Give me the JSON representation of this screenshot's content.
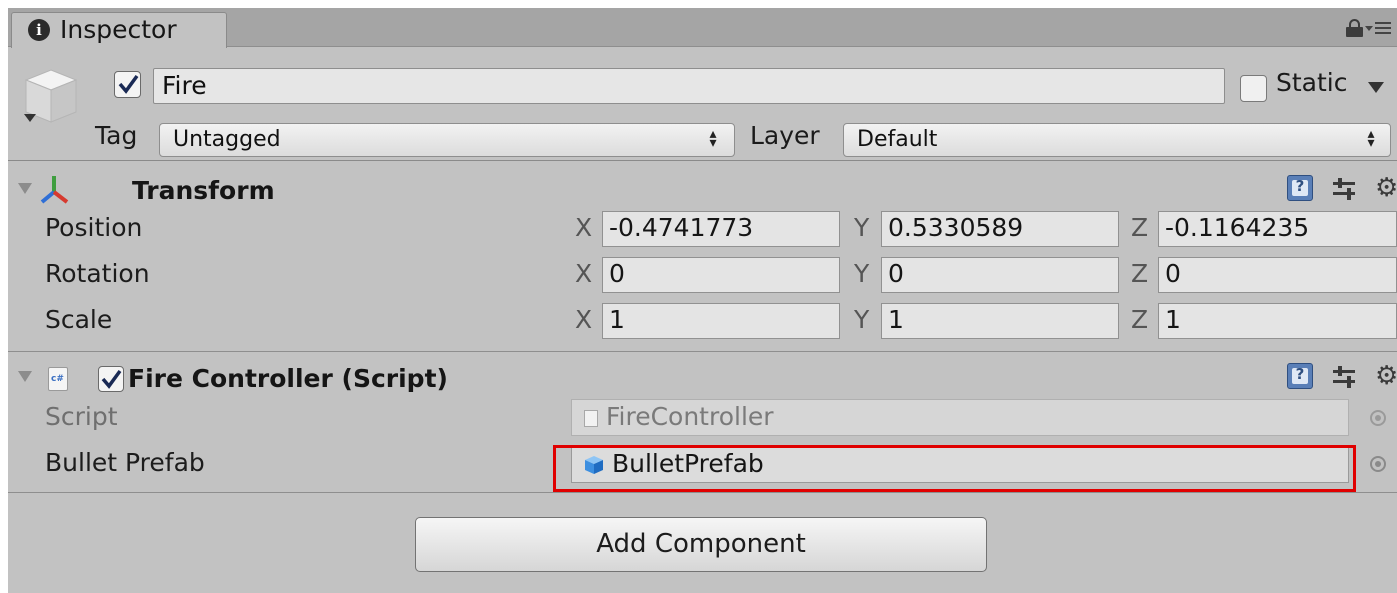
{
  "tab": {
    "label": "Inspector",
    "info_icon": "i",
    "lock_icon": "lock-icon",
    "menu_icon": "tab-menu-icon"
  },
  "game_object": {
    "icon": "gameobject-cube-icon",
    "active": true,
    "name": "Fire",
    "static_label": "Static",
    "static_checked": false,
    "tag_label": "Tag",
    "tag_value": "Untagged",
    "layer_label": "Layer",
    "layer_value": "Default"
  },
  "transform": {
    "title": "Transform",
    "icon": "transform-axes-icon",
    "rows": [
      {
        "label": "Position",
        "x": "-0.4741773",
        "y": "0.5330589",
        "z": "-0.1164235"
      },
      {
        "label": "Rotation",
        "x": "0",
        "y": "0",
        "z": "0"
      },
      {
        "label": "Scale",
        "x": "1",
        "y": "1",
        "z": "1"
      }
    ],
    "axes": {
      "x": "X",
      "y": "Y",
      "z": "Z"
    }
  },
  "fire_controller": {
    "title": "Fire Controller (Script)",
    "enabled": true,
    "icon": "csharp-script-icon",
    "script_label": "Script",
    "script_value": "FireController",
    "bullet_label": "Bullet Prefab",
    "bullet_value": "BulletPrefab"
  },
  "component_tools": {
    "help_icon": "?",
    "preset_icon": "preset-icon",
    "settings_icon": "gear-icon"
  },
  "add_component": {
    "label": "Add Component"
  },
  "colors": {
    "panel": "#c2c2c2",
    "tab_bar": "#a5a5a5",
    "field": "#e4e4e4",
    "highlight": "#e00000"
  }
}
